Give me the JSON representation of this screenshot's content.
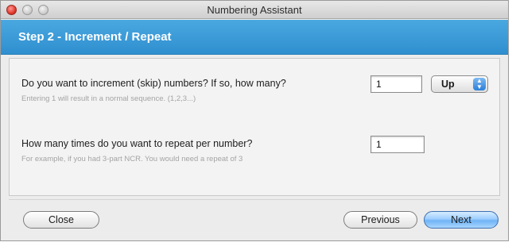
{
  "window": {
    "title": "Numbering Assistant"
  },
  "step": {
    "title": "Step 2 - Increment / Repeat"
  },
  "increment": {
    "question": "Do you want to increment (skip) numbers? If so, how many?",
    "value": "1",
    "hint": "Entering 1 will result in a normal sequence. (1,2,3...)",
    "direction": "Up"
  },
  "repeat": {
    "question": "How many times do you want to repeat per number?",
    "value": "1",
    "hint": "For example, if you had 3-part NCR. You would need a repeat of 3"
  },
  "buttons": {
    "close": "Close",
    "previous": "Previous",
    "next": "Next"
  },
  "colors": {
    "banner": "#3a9bd8",
    "default_button": "#8cc5fb",
    "close_light": "#e0392f"
  },
  "icons": {
    "select_arrows": "up-down-chevron-icon"
  }
}
